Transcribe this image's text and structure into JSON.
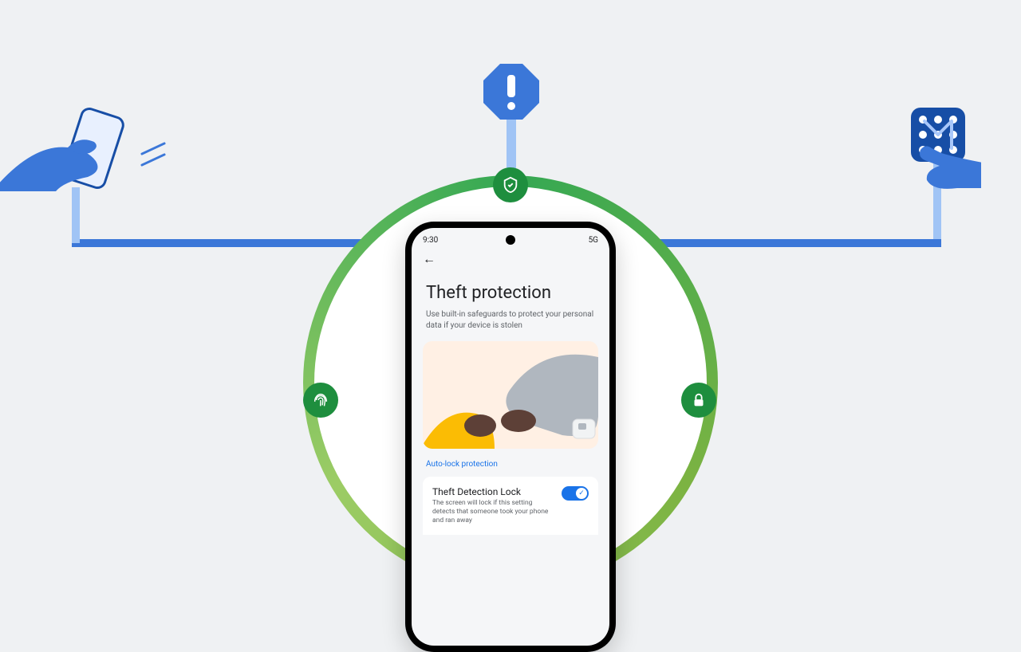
{
  "alert": {
    "name": "alert-octagon"
  },
  "left_illustration": {
    "name": "hand-grabbing-phone"
  },
  "right_illustration": {
    "name": "finger-entering-pin"
  },
  "ring_badges": {
    "top": "shield",
    "left": "fingerprint",
    "right": "lock"
  },
  "phone": {
    "status": {
      "time": "9:30",
      "network": "5G"
    },
    "back_icon": "←",
    "title": "Theft protection",
    "subtitle": "Use built-in safeguards to protect your personal data if your device is stolen",
    "section_label": "Auto-lock protection",
    "setting": {
      "title": "Theft Detection Lock",
      "desc": "The screen will lock if this setting detects that someone took your phone and ran away",
      "toggled": true
    }
  }
}
